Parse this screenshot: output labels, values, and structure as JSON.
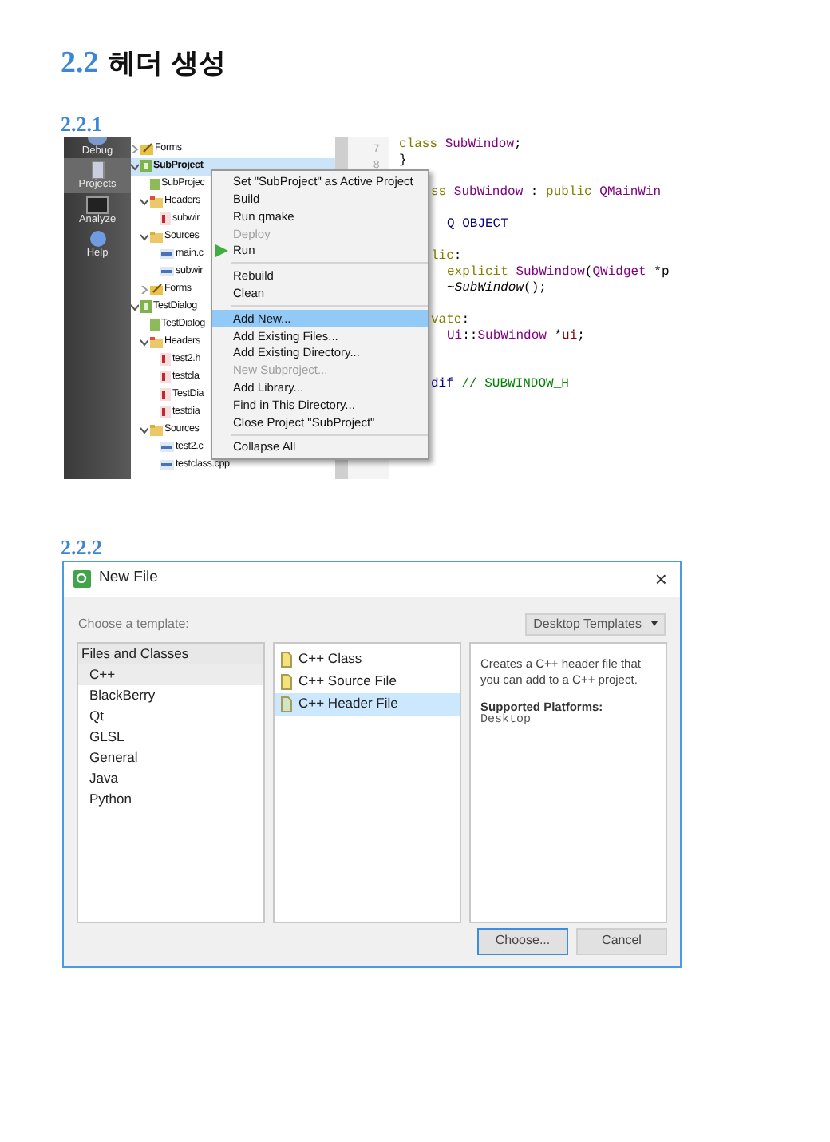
{
  "heading": {
    "number": "2.2",
    "title": "헤더 생성"
  },
  "section_1": {
    "number": "2.2.1",
    "ide": {
      "sidebar": [
        {
          "label": "Debug",
          "kind": "debug",
          "selected": false
        },
        {
          "label": "Projects",
          "kind": "projects",
          "selected": true
        },
        {
          "label": "Analyze",
          "kind": "analyze",
          "selected": false
        },
        {
          "label": "Help",
          "kind": "help",
          "selected": false
        }
      ],
      "tree": [
        {
          "label": "Forms",
          "kind": "forms",
          "expanded": false,
          "selected": false,
          "bold": false
        },
        {
          "label": "SubProject",
          "kind": "project",
          "expanded": true,
          "selected": true,
          "bold": true,
          "children": [
            {
              "label": "SubProjec",
              "kind": "profile",
              "selected": false,
              "bold": false
            },
            {
              "label": "Headers",
              "kind": "headers",
              "expanded": true,
              "selected": false,
              "bold": false,
              "children": [
                {
                  "label": "subwir",
                  "kind": "header",
                  "selected": false,
                  "bold": false
                }
              ]
            },
            {
              "label": "Sources",
              "kind": "sources",
              "expanded": true,
              "selected": false,
              "bold": false,
              "children": [
                {
                  "label": "main.c",
                  "kind": "cpp",
                  "selected": false,
                  "bold": false
                },
                {
                  "label": "subwir",
                  "kind": "cpp",
                  "selected": false,
                  "bold": false
                }
              ]
            },
            {
              "label": "Forms",
              "kind": "forms",
              "expanded": false,
              "selected": false,
              "bold": false
            }
          ]
        },
        {
          "label": "TestDialog",
          "kind": "project",
          "expanded": true,
          "selected": false,
          "bold": false,
          "children": [
            {
              "label": "TestDialog",
              "kind": "profile",
              "selected": false,
              "bold": false
            },
            {
              "label": "Headers",
              "kind": "headers",
              "expanded": true,
              "selected": false,
              "bold": false,
              "children": [
                {
                  "label": "test2.h",
                  "kind": "header",
                  "selected": false,
                  "bold": false
                },
                {
                  "label": "testcla",
                  "kind": "header",
                  "selected": false,
                  "bold": false
                },
                {
                  "label": "TestDia",
                  "kind": "header",
                  "selected": false,
                  "bold": false
                },
                {
                  "label": "testdia",
                  "kind": "header",
                  "selected": false,
                  "bold": false
                }
              ]
            },
            {
              "label": "Sources",
              "kind": "sources",
              "expanded": true,
              "selected": false,
              "bold": false,
              "children": [
                {
                  "label": "test2.c",
                  "kind": "cpp",
                  "selected": false,
                  "bold": false
                },
                {
                  "label": "testclass.cpp",
                  "kind": "cpp",
                  "selected": false,
                  "bold": false
                }
              ]
            }
          ]
        }
      ],
      "code_lines": [
        {
          "kind": "code",
          "number": "7",
          "segments": [
            {
              "kind": "keyword",
              "text": "class"
            },
            {
              "kind": "type",
              "text": " SubWindow"
            },
            {
              "kind": "plain",
              "text": ";"
            }
          ]
        },
        {
          "kind": "code",
          "number": "8",
          "segments": [
            {
              "kind": "plain",
              "text": "}"
            }
          ]
        },
        {
          "kind": "blank"
        },
        {
          "kind": "code",
          "segments": [
            {
              "kind": "keyword",
              "text": "ss"
            },
            {
              "kind": "type",
              "text": " SubWindow"
            },
            {
              "kind": "plain",
              "text": " : "
            },
            {
              "kind": "keyword",
              "text": "public"
            },
            {
              "kind": "type",
              "text": " QMainWin"
            }
          ]
        },
        {
          "kind": "blank"
        },
        {
          "kind": "code",
          "indented": true,
          "segments": [
            {
              "kind": "macro",
              "text": "Q_OBJECT"
            }
          ]
        },
        {
          "kind": "blank"
        },
        {
          "kind": "code",
          "segments": [
            {
              "kind": "keyword",
              "text": "lic"
            },
            {
              "kind": "plain",
              "text": ":"
            }
          ]
        },
        {
          "kind": "code",
          "indented": true,
          "segments": [
            {
              "kind": "keyword",
              "text": "explicit"
            },
            {
              "kind": "type",
              "text": " SubWindow"
            },
            {
              "kind": "plain",
              "text": "("
            },
            {
              "kind": "type",
              "text": "QWidget"
            },
            {
              "kind": "plain",
              "text": " *p"
            }
          ]
        },
        {
          "kind": "code",
          "indented": true,
          "segments": [
            {
              "kind": "plain",
              "text": "~"
            },
            {
              "kind": "decl",
              "text": "SubWindow"
            },
            {
              "kind": "plain",
              "text": "();"
            }
          ]
        },
        {
          "kind": "blank"
        },
        {
          "kind": "code",
          "segments": [
            {
              "kind": "keyword",
              "text": "vate"
            },
            {
              "kind": "plain",
              "text": ":"
            }
          ]
        },
        {
          "kind": "code",
          "indented": true,
          "segments": [
            {
              "kind": "type",
              "text": "Ui"
            },
            {
              "kind": "plain",
              "text": "::"
            },
            {
              "kind": "type",
              "text": "SubWindow"
            },
            {
              "kind": "plain",
              "text": " *"
            },
            {
              "kind": "member",
              "text": "ui"
            },
            {
              "kind": "plain",
              "text": ";"
            }
          ]
        },
        {
          "kind": "blank"
        },
        {
          "kind": "blank"
        },
        {
          "kind": "code",
          "segments": [
            {
              "kind": "preproc",
              "text": "dif"
            },
            {
              "kind": "comment",
              "text": " // SUBWINDOW_H"
            }
          ]
        }
      ],
      "context_menu": [
        {
          "kind": "item",
          "label": "Set \"SubProject\" as Active Project",
          "disabled": false,
          "selected": false
        },
        {
          "kind": "item",
          "label": "Build",
          "disabled": false,
          "selected": false
        },
        {
          "kind": "item",
          "label": "Run qmake",
          "disabled": false,
          "selected": false
        },
        {
          "kind": "item",
          "label": "Deploy",
          "disabled": true,
          "selected": false
        },
        {
          "kind": "play",
          "label": "Run",
          "disabled": false,
          "selected": false
        },
        {
          "kind": "separator"
        },
        {
          "kind": "item",
          "label": "Rebuild",
          "disabled": false,
          "selected": false
        },
        {
          "kind": "item",
          "label": "Clean",
          "disabled": false,
          "selected": false
        },
        {
          "kind": "separator"
        },
        {
          "kind": "item",
          "label": "Add New...",
          "disabled": false,
          "selected": true
        },
        {
          "kind": "item",
          "label": "Add Existing Files...",
          "disabled": false,
          "selected": false
        },
        {
          "kind": "item",
          "label": "Add Existing Directory...",
          "disabled": false,
          "selected": false
        },
        {
          "kind": "item",
          "label": "New Subproject...",
          "disabled": true,
          "selected": false
        },
        {
          "kind": "item",
          "label": "Add Library...",
          "disabled": false,
          "selected": false
        },
        {
          "kind": "item",
          "label": "Find in This Directory...",
          "disabled": false,
          "selected": false
        },
        {
          "kind": "item",
          "label": "Close Project \"SubProject\"",
          "disabled": false,
          "selected": false
        },
        {
          "kind": "separator"
        },
        {
          "kind": "item",
          "label": "Collapse All",
          "disabled": false,
          "selected": false
        }
      ]
    }
  },
  "section_2": {
    "number": "2.2.2",
    "dialog": {
      "title": "New File",
      "close": "×",
      "prompt": "Choose a template:",
      "filter": "Desktop Templates",
      "categories_header": "Files and Classes",
      "categories": [
        {
          "label": "C++",
          "selected": true
        },
        {
          "label": "BlackBerry",
          "selected": false
        },
        {
          "label": "Qt",
          "selected": false
        },
        {
          "label": "GLSL",
          "selected": false
        },
        {
          "label": "General",
          "selected": false
        },
        {
          "label": "Java",
          "selected": false
        },
        {
          "label": "Python",
          "selected": false
        }
      ],
      "templates": [
        {
          "label": "C++ Class",
          "kind": "class",
          "selected": false
        },
        {
          "label": "C++ Source File",
          "kind": "source",
          "selected": false
        },
        {
          "label": "C++ Header File",
          "kind": "header",
          "selected": true
        }
      ],
      "description": "Creates a C++ header file that you can add to a C++ project.",
      "platforms_label": "Supported Platforms:",
      "platforms": "Desktop",
      "buttons": [
        {
          "label": "Choose...",
          "default": true
        },
        {
          "label": "Cancel",
          "default": false
        }
      ]
    }
  }
}
